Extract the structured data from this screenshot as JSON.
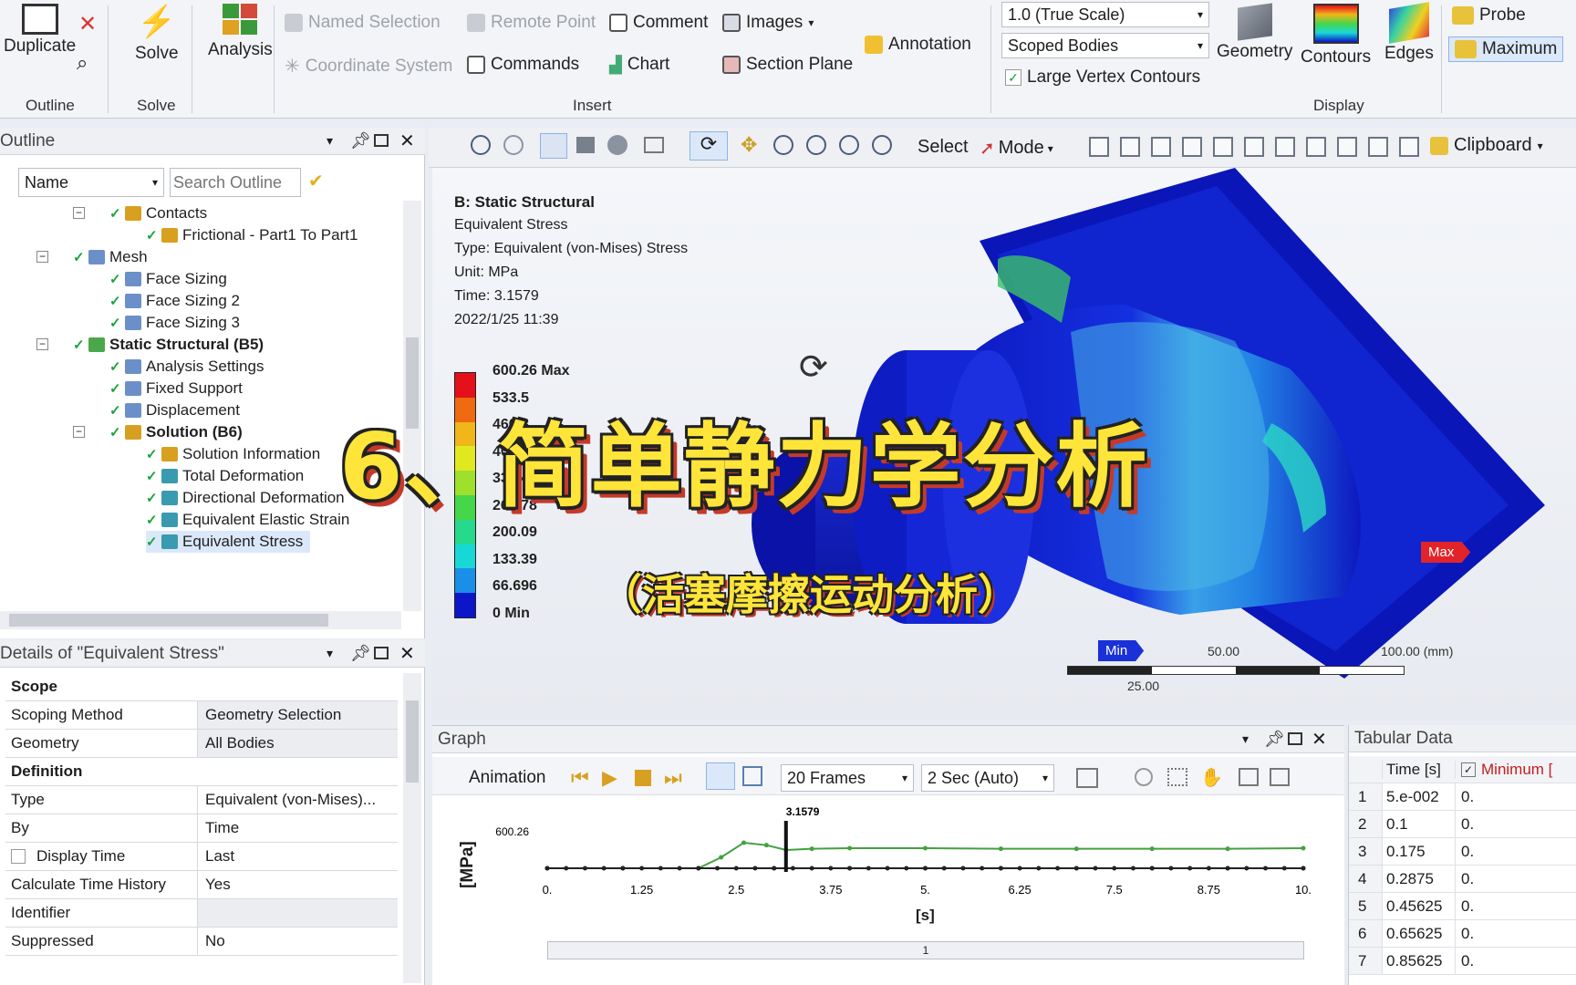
{
  "ribbon": {
    "duplicate": "Duplicate",
    "solve": "Solve",
    "analysis": "Analysis",
    "named_selection": "Named Selection",
    "remote_point": "Remote Point",
    "comment": "Comment",
    "images": "Images",
    "annotation": "Annotation",
    "coordinate_system": "Coordinate System",
    "commands": "Commands",
    "chart": "Chart",
    "section_plane": "Section Plane",
    "scale_combo": "1.0 (True Scale)",
    "scoped_combo": "Scoped Bodies",
    "large_vertex": "Large Vertex Contours",
    "geometry": "Geometry",
    "contours": "Contours",
    "edges": "Edges",
    "probe": "Probe",
    "maximum": "Maximum",
    "group_outline": "Outline",
    "group_solve": "Solve",
    "group_insert": "Insert",
    "group_display": "Display"
  },
  "toolbar": {
    "select": "Select",
    "mode": "Mode",
    "clipboard": "Clipboard"
  },
  "outline": {
    "title": "Outline",
    "name_combo": "Name",
    "search_placeholder": "Search Outline",
    "items": [
      {
        "label": "Contacts",
        "bold": false
      },
      {
        "label": "Frictional - Part1 To Part1",
        "bold": false
      },
      {
        "label": "Mesh",
        "bold": false
      },
      {
        "label": "Face Sizing",
        "bold": false
      },
      {
        "label": "Face Sizing 2",
        "bold": false
      },
      {
        "label": "Face Sizing 3",
        "bold": false
      },
      {
        "label": "Static Structural (B5)",
        "bold": true
      },
      {
        "label": "Analysis Settings",
        "bold": false
      },
      {
        "label": "Fixed Support",
        "bold": false
      },
      {
        "label": "Displacement",
        "bold": false
      },
      {
        "label": "Solution (B6)",
        "bold": true
      },
      {
        "label": "Solution Information",
        "bold": false
      },
      {
        "label": "Total Deformation",
        "bold": false
      },
      {
        "label": "Directional Deformation",
        "bold": false
      },
      {
        "label": "Equivalent Elastic Strain",
        "bold": false
      },
      {
        "label": "Equivalent Stress",
        "bold": false
      }
    ]
  },
  "details": {
    "title": "Details of \"Equivalent Stress\"",
    "rows": [
      {
        "k": "Scope",
        "v": "",
        "header": true
      },
      {
        "k": "Scoping Method",
        "v": "Geometry Selection"
      },
      {
        "k": "Geometry",
        "v": "All Bodies"
      },
      {
        "k": "Definition",
        "v": "",
        "header": true
      },
      {
        "k": "Type",
        "v": "Equivalent (von-Mises)..."
      },
      {
        "k": "By",
        "v": "Time"
      },
      {
        "k": "Display Time",
        "v": "Last"
      },
      {
        "k": "Calculate Time History",
        "v": "Yes"
      },
      {
        "k": "Identifier",
        "v": ""
      },
      {
        "k": "Suppressed",
        "v": "No"
      }
    ]
  },
  "viewport": {
    "result_title": "B: Static Structural",
    "result_name": "Equivalent Stress",
    "result_type": "Type: Equivalent (von-Mises) Stress",
    "unit": "Unit: MPa",
    "time": "Time: 3.1579",
    "date": "2022/1/25 11:39",
    "legend": [
      "600.26 Max",
      "533.5",
      "466.8",
      "400.1",
      "333.4",
      "266.78",
      "200.09",
      "133.39",
      "66.696",
      "0 Min"
    ],
    "legend_colors": [
      "#e4101a",
      "#ef6a10",
      "#f0b61a",
      "#e2e81f",
      "#9ee02c",
      "#45d64a",
      "#27d98c",
      "#18d8d6",
      "#1a8fe8",
      "#0c16c8"
    ],
    "max_tag": "Max",
    "min_tag": "Min",
    "scale_labels": [
      "50.00",
      "100.00 (mm)",
      "25.00"
    ],
    "overlay_title": "6、简单静力学分析",
    "overlay_subtitle": "（活塞摩擦运动分析）"
  },
  "graph": {
    "title": "Graph",
    "animation": "Animation",
    "frames": "20 Frames",
    "duration": "2 Sec (Auto)",
    "ylabel": "[MPa]",
    "xlabel": "[s]",
    "y_tick": "600.26",
    "marker": "3.1579",
    "x_ticks": [
      "0.",
      "1.25",
      "2.5",
      "3.75",
      "5.",
      "6.25",
      "7.5",
      "8.75",
      "10."
    ],
    "scroll_label": "1"
  },
  "chart_data": {
    "type": "line",
    "title": "",
    "xlabel": "[s]",
    "ylabel": "[MPa]",
    "xlim": [
      0,
      10
    ],
    "ylim": [
      0,
      600.26
    ],
    "series": [
      {
        "name": "",
        "x": [
          0,
          1,
          2,
          2.3,
          2.6,
          2.9,
          3.16,
          3.5,
          4,
          5,
          6,
          7,
          8,
          9,
          10
        ],
        "values": [
          0,
          0,
          0,
          180,
          420,
          380,
          300,
          320,
          330,
          330,
          320,
          320,
          320,
          320,
          330
        ],
        "color": "#44a040"
      },
      {
        "name": "",
        "x": [
          0,
          1,
          2,
          3,
          4,
          5,
          6,
          7,
          8,
          9,
          10
        ],
        "values": [
          0,
          0,
          0,
          0,
          0,
          0,
          0,
          0,
          0,
          0,
          0
        ],
        "color": "#222222"
      }
    ]
  },
  "tabular": {
    "title": "Tabular Data",
    "col_time": "Time [s]",
    "col_min": "Minimum [",
    "rows": [
      {
        "n": "1",
        "t": "5.e-002",
        "m": "0."
      },
      {
        "n": "2",
        "t": "0.1",
        "m": "0."
      },
      {
        "n": "3",
        "t": "0.175",
        "m": "0."
      },
      {
        "n": "4",
        "t": "0.2875",
        "m": "0."
      },
      {
        "n": "5",
        "t": "0.45625",
        "m": "0."
      },
      {
        "n": "6",
        "t": "0.65625",
        "m": "0."
      },
      {
        "n": "7",
        "t": "0.85625",
        "m": "0."
      }
    ]
  }
}
